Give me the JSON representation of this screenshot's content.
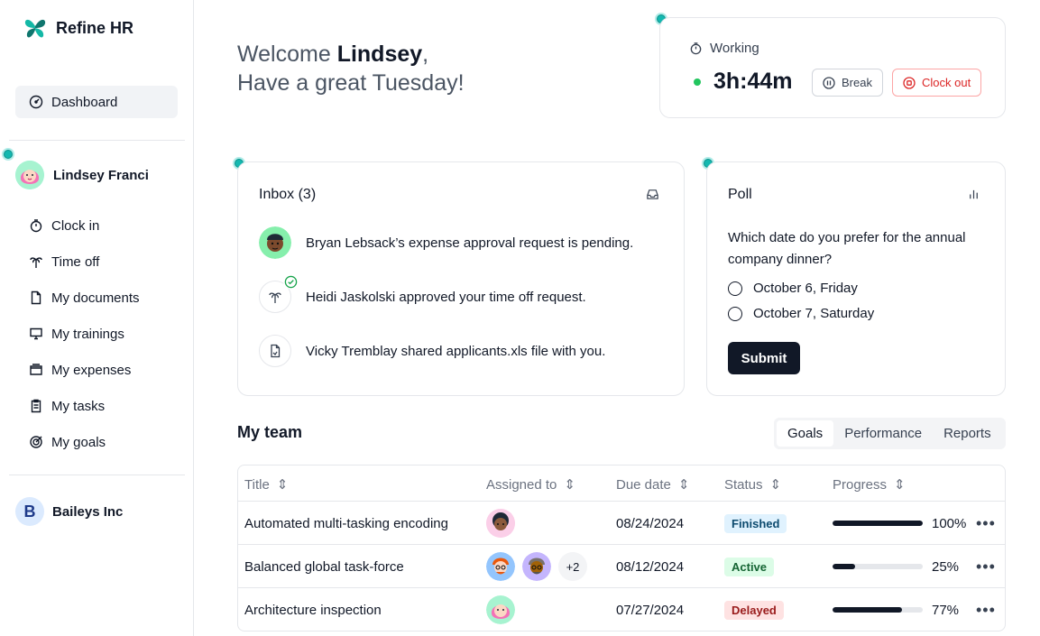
{
  "brand": {
    "name": "Refine HR",
    "accent": "#14b8a6"
  },
  "sidebar": {
    "active_item": {
      "label": "Dashboard",
      "icon": "dashboard-icon"
    },
    "user": {
      "name": "Lindsey Franci"
    },
    "items": [
      {
        "label": "Clock in",
        "icon": "stopwatch-icon"
      },
      {
        "label": "Time off",
        "icon": "palm-tree-icon"
      },
      {
        "label": "My documents",
        "icon": "document-icon"
      },
      {
        "label": "My trainings",
        "icon": "presentation-icon"
      },
      {
        "label": "My expenses",
        "icon": "wallet-icon"
      },
      {
        "label": "My tasks",
        "icon": "clipboard-icon"
      },
      {
        "label": "My goals",
        "icon": "target-icon"
      }
    ],
    "org": {
      "initial": "B",
      "name": "Baileys Inc"
    }
  },
  "welcome": {
    "prefix": "Welcome ",
    "name": "Lindsey",
    "suffix": ",",
    "line2": "Have a great Tuesday!"
  },
  "working": {
    "status": "Working",
    "time": "3h:44m",
    "break_label": "Break",
    "clockout_label": "Clock out",
    "status_color": "#22c55e"
  },
  "inbox": {
    "title": "Inbox (3)",
    "items": [
      {
        "text": "Bryan Lebsack’s expense approval request is pending.",
        "icon": "avatar"
      },
      {
        "text": "Heidi Jaskolski approved your time off request.",
        "icon": "palm-tree-icon"
      },
      {
        "text": "Vicky Tremblay shared applicants.xls file with you.",
        "icon": "file-icon"
      }
    ]
  },
  "poll": {
    "title": "Poll",
    "question": "Which date do you prefer for the annual company dinner?",
    "options": [
      "October 6, Friday",
      "October 7, Saturday"
    ],
    "submit_label": "Submit"
  },
  "team": {
    "title": "My team",
    "tabs": [
      "Goals",
      "Performance",
      "Reports"
    ],
    "active_tab": "Goals",
    "columns": [
      "Title",
      "Assigned to",
      "Due date",
      "Status",
      "Progress"
    ],
    "rows": [
      {
        "title": "Automated multi-tasking encoding",
        "assignees": 1,
        "extra": "",
        "due": "08/24/2024",
        "status": "Finished",
        "status_bg": "#e0f2fe",
        "status_fg": "#0c4a6e",
        "progress": 100,
        "progress_label": "100%"
      },
      {
        "title": "Balanced global task-force",
        "assignees": 2,
        "extra": "+2",
        "due": "08/12/2024",
        "status": "Active",
        "status_bg": "#dcfce7",
        "status_fg": "#166534",
        "progress": 25,
        "progress_label": "25%"
      },
      {
        "title": "Architecture inspection",
        "assignees": 1,
        "extra": "",
        "due": "07/27/2024",
        "status": "Delayed",
        "status_bg": "#fee2e2",
        "status_fg": "#991b1b",
        "progress": 77,
        "progress_label": "77%"
      }
    ]
  }
}
